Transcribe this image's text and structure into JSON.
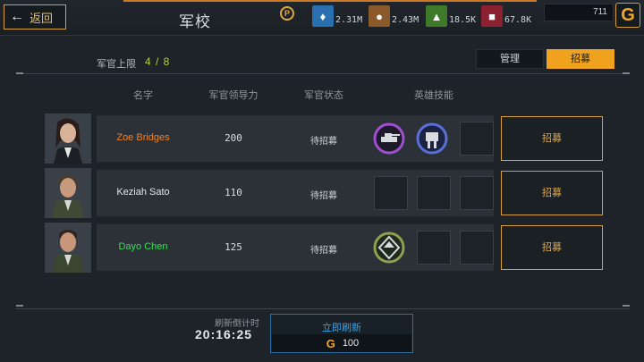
{
  "header": {
    "back_label": "返回",
    "title": "军校",
    "timer_glyph": "P",
    "resources": [
      {
        "icon": "steel-icon",
        "value": "2.31M",
        "color": "#2a6fb0"
      },
      {
        "icon": "oil-icon",
        "value": "2.43M",
        "color": "#8b5a2a"
      },
      {
        "icon": "crystal-icon",
        "value": "18.5K",
        "color": "#3f7a2b"
      },
      {
        "icon": "supply-icon",
        "value": "67.8K",
        "color": "#8b2030"
      }
    ],
    "gold": "711",
    "gold_glyph": "G"
  },
  "academy": {
    "capacity_label": "军官上限",
    "capacity_value": "4 / 8",
    "tabs": {
      "manage": "管理",
      "recruit": "招募"
    },
    "columns": {
      "name": "名字",
      "leadership": "军官领导力",
      "status": "军官状态",
      "skills": "英雄技能"
    },
    "officers": [
      {
        "name": "Zoe Bridges",
        "name_color": "#f0822a",
        "leadership": "200",
        "status": "待招募",
        "skills": [
          "tank-skill-icon",
          "robot-skill-icon",
          "empty"
        ],
        "button": "招募"
      },
      {
        "name": "Keziah Sato",
        "name_color": "#e4e7ea",
        "leadership": "110",
        "status": "待招募",
        "skills": [
          "empty",
          "empty",
          "empty"
        ],
        "button": "招募"
      },
      {
        "name": "Dayo Chen",
        "name_color": "#3ddc5a",
        "leadership": "125",
        "status": "待招募",
        "skills": [
          "upgrade-skill-icon",
          "empty",
          "empty"
        ],
        "button": "招募"
      }
    ]
  },
  "refresh": {
    "countdown_label": "刷新倒计时",
    "countdown": "20:16:25",
    "button_label": "立即刷新",
    "cost": "100",
    "coin_glyph": "G"
  }
}
